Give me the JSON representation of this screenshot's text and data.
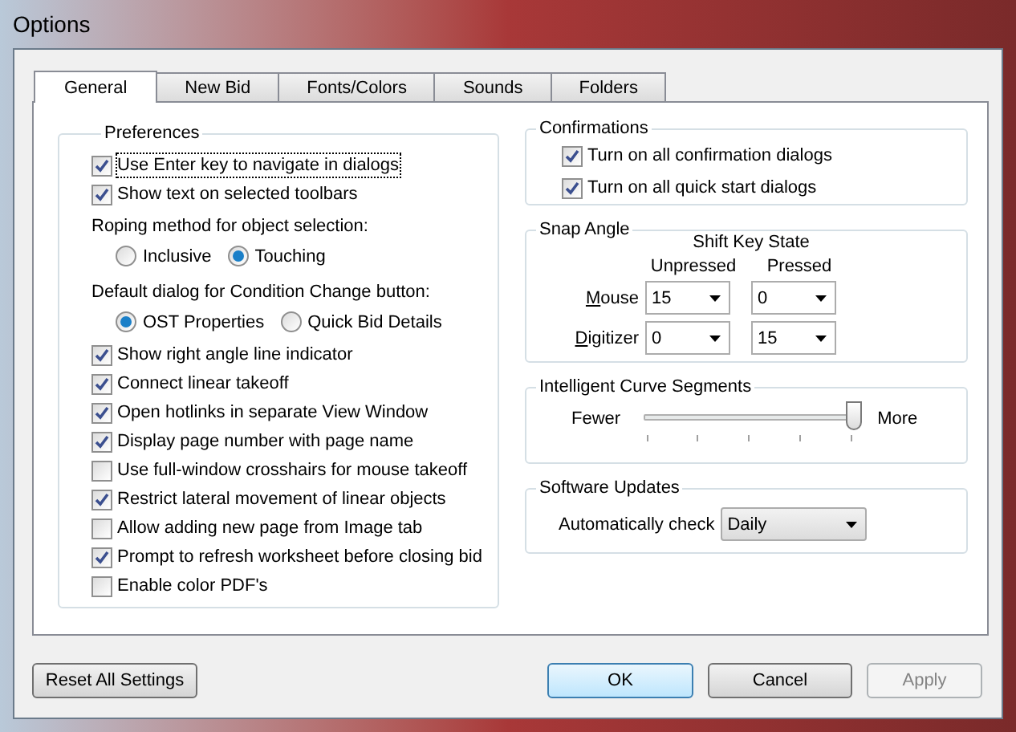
{
  "window": {
    "title": "Options"
  },
  "tabs": [
    {
      "label": "General",
      "selected": true
    },
    {
      "label": "New Bid",
      "selected": false
    },
    {
      "label": "Fonts/Colors",
      "selected": false
    },
    {
      "label": "Sounds",
      "selected": false
    },
    {
      "label": "Folders",
      "selected": false
    }
  ],
  "preferences": {
    "title": "Preferences",
    "items": [
      {
        "kind": "checkbox",
        "label": "Use Enter key to navigate in dialogs",
        "checked": true,
        "focused": true
      },
      {
        "kind": "checkbox",
        "label": "Show text on selected toolbars",
        "checked": true
      },
      {
        "kind": "heading",
        "text": "Roping method for object selection:"
      },
      {
        "kind": "radios",
        "options": [
          {
            "label": "Inclusive",
            "selected": false
          },
          {
            "label": "Touching",
            "selected": true
          }
        ]
      },
      {
        "kind": "heading",
        "text": "Default dialog for Condition Change button:"
      },
      {
        "kind": "radios",
        "options": [
          {
            "label": "OST Properties",
            "selected": true
          },
          {
            "label": "Quick Bid Details",
            "selected": false
          }
        ]
      },
      {
        "kind": "checkbox",
        "label": "Show right angle line indicator",
        "checked": true
      },
      {
        "kind": "checkbox",
        "label": "Connect linear takeoff",
        "checked": true
      },
      {
        "kind": "checkbox",
        "label": "Open hotlinks in separate View Window",
        "checked": true
      },
      {
        "kind": "checkbox",
        "label": "Display page number with page name",
        "checked": true
      },
      {
        "kind": "checkbox",
        "label": "Use full-window crosshairs for mouse takeoff",
        "checked": false
      },
      {
        "kind": "checkbox",
        "label": "Restrict lateral movement of linear objects",
        "checked": true
      },
      {
        "kind": "checkbox",
        "label": "Allow adding new page from Image tab",
        "checked": false
      },
      {
        "kind": "checkbox",
        "label": "Prompt to refresh worksheet before closing bid",
        "checked": true
      },
      {
        "kind": "checkbox",
        "label": "Enable color PDF's",
        "checked": false
      }
    ]
  },
  "confirmations": {
    "title": "Confirmations",
    "items": [
      {
        "label": "Turn on all confirmation dialogs",
        "checked": true
      },
      {
        "label": "Turn on all quick start dialogs",
        "checked": true
      }
    ]
  },
  "snap_angle": {
    "title": "Snap Angle",
    "header": "Shift Key State",
    "columns": [
      "Unpressed",
      "Pressed"
    ],
    "rows": [
      {
        "label": "Mouse",
        "values": [
          "15",
          "0"
        ]
      },
      {
        "label": "Digitizer",
        "values": [
          "0",
          "15"
        ]
      }
    ]
  },
  "curve_segments": {
    "title": "Intelligent Curve Segments",
    "min_label": "Fewer",
    "max_label": "More",
    "level": 1
  },
  "software_updates": {
    "title": "Software Updates",
    "label": "Automatically check",
    "value": "Daily"
  },
  "buttons": [
    {
      "label": "Reset All Settings",
      "kind": "normal"
    },
    {
      "label": "OK",
      "kind": "default"
    },
    {
      "label": "Cancel",
      "kind": "normal"
    },
    {
      "label": "Apply",
      "kind": "disabled"
    }
  ]
}
